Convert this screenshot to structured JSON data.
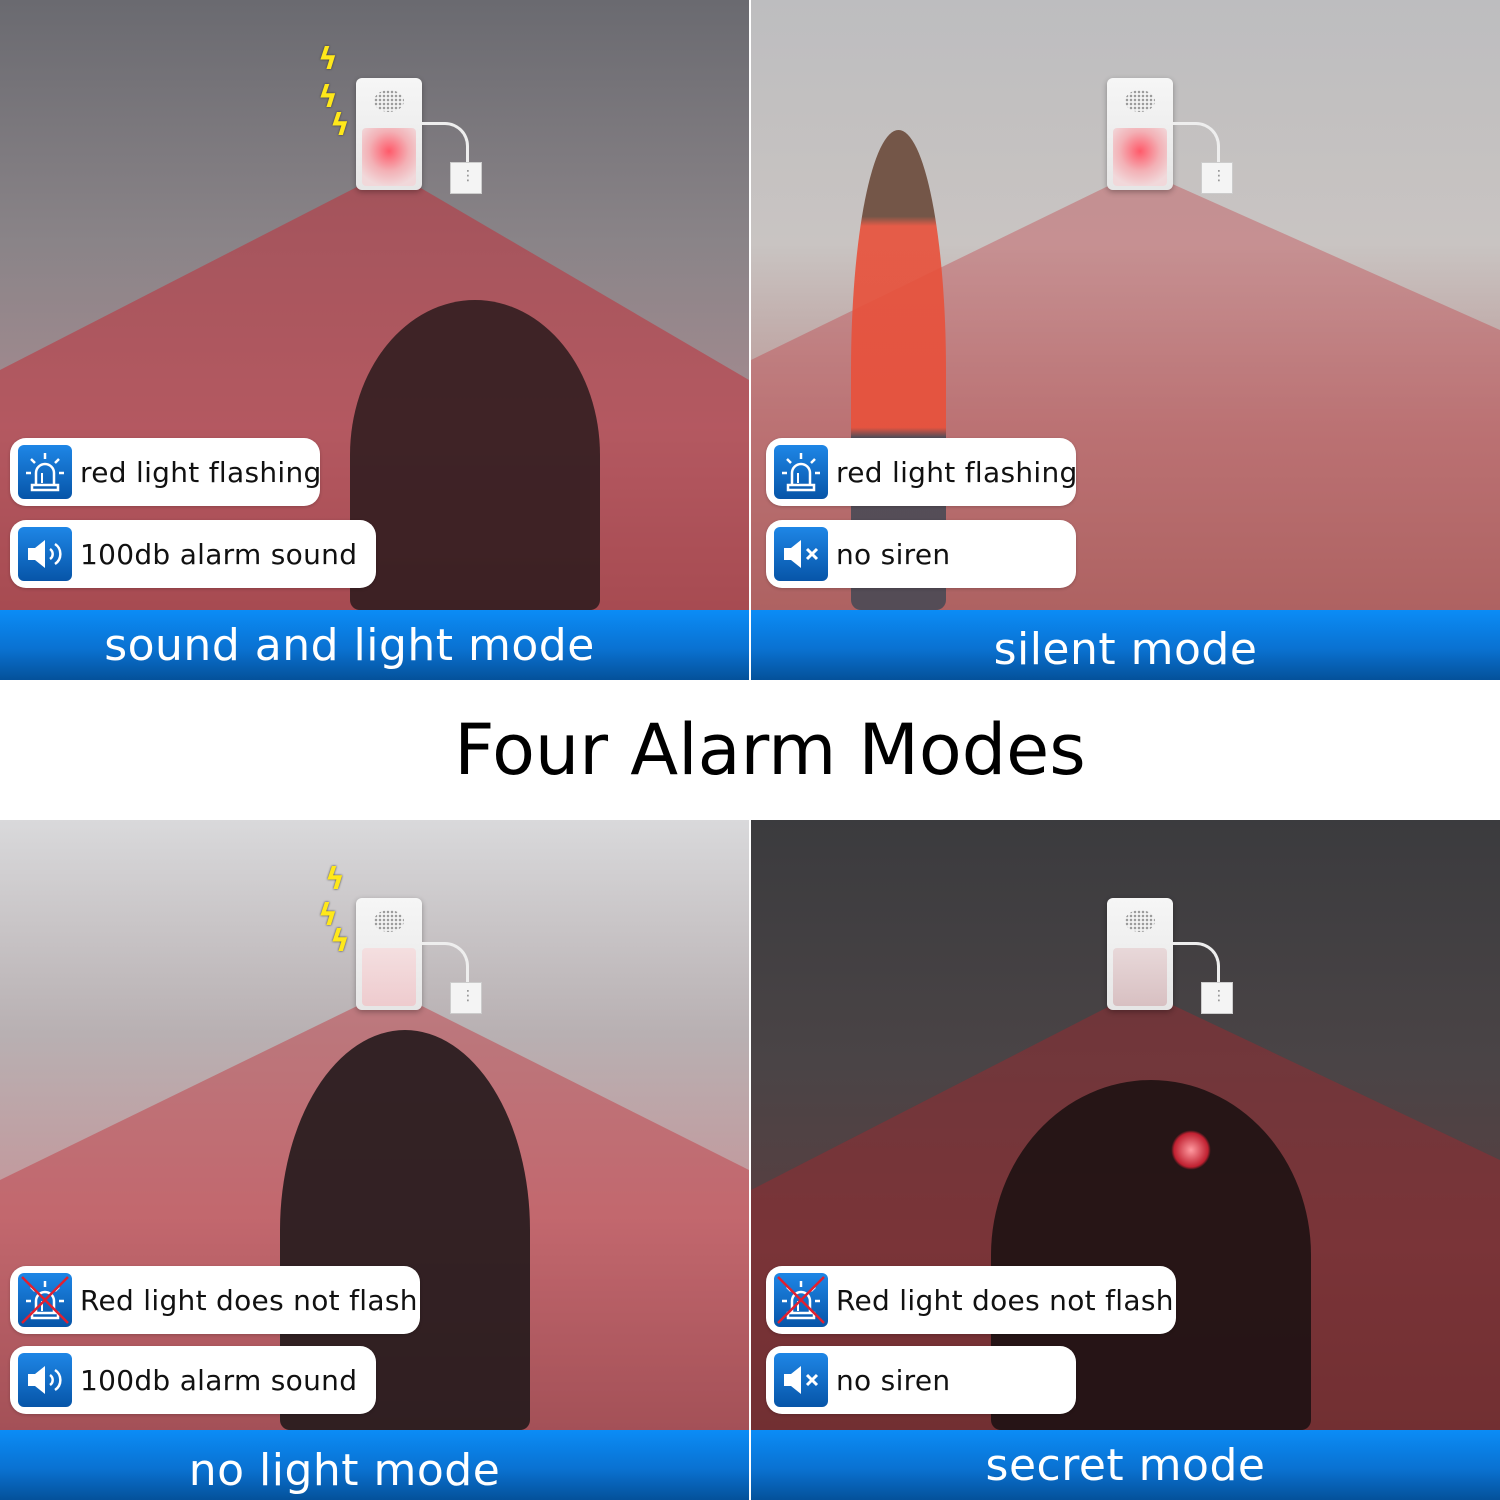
{
  "title": "Four Alarm Modes",
  "colors": {
    "band_top": "#0b8cf6",
    "band_bottom": "#04519a",
    "icon_blue": "#1e86e6",
    "beam_red": "#c0303a",
    "bolt_yellow": "#ffe81a"
  },
  "modes": [
    {
      "name": "sound and light mode",
      "features": [
        {
          "icon": "siren-light-icon",
          "label": "red light flashing"
        },
        {
          "icon": "speaker-sound-icon",
          "label": "100db alarm sound"
        }
      ]
    },
    {
      "name": "silent mode",
      "features": [
        {
          "icon": "siren-light-icon",
          "label": "red light flashing"
        },
        {
          "icon": "speaker-mute-icon",
          "label": "no siren"
        }
      ]
    },
    {
      "name": "no light mode",
      "features": [
        {
          "icon": "siren-light-crossed-icon",
          "label": "Red light does not flash"
        },
        {
          "icon": "speaker-sound-icon",
          "label": "100db alarm sound"
        }
      ]
    },
    {
      "name": "secret mode",
      "features": [
        {
          "icon": "siren-light-crossed-icon",
          "label": "Red light does not flash"
        },
        {
          "icon": "speaker-mute-icon",
          "label": "no siren"
        }
      ]
    }
  ]
}
